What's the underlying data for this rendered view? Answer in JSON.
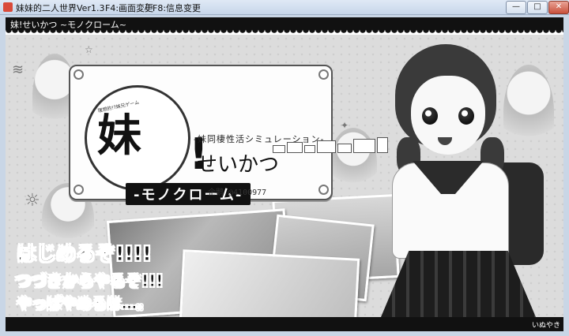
{
  "window": {
    "title": "妹妹的二人世界Ver1.3",
    "menu_f4": "F4:画面変更",
    "menu_separator": "/",
    "menu_f8": "F8:信息变更",
    "min_label": "—",
    "max_label": "□",
    "close_label": "✕"
  },
  "game": {
    "top_band_text": "妹!せいかつ ~モノクローム~",
    "logo": {
      "tagline": "理想的!?妹兄ゲーム",
      "kanji": "妹",
      "exclaim": "!",
      "subtitle": "-妹同棲性活シミュレーション-",
      "seikatsu": "せいかつ",
      "monochrome": "-モノクローム-"
    },
    "qq": "企鹅 @4100977",
    "menu": {
      "start": "はじめるぞ!!!!",
      "continue": "つづきからやるぞ!!!",
      "quit": "やっぱやめるは…。"
    },
    "signature": "いぬやき"
  },
  "colors": {
    "titlebar": "#c7d6ea",
    "band": "#111111",
    "background": "#dcdcdc"
  }
}
